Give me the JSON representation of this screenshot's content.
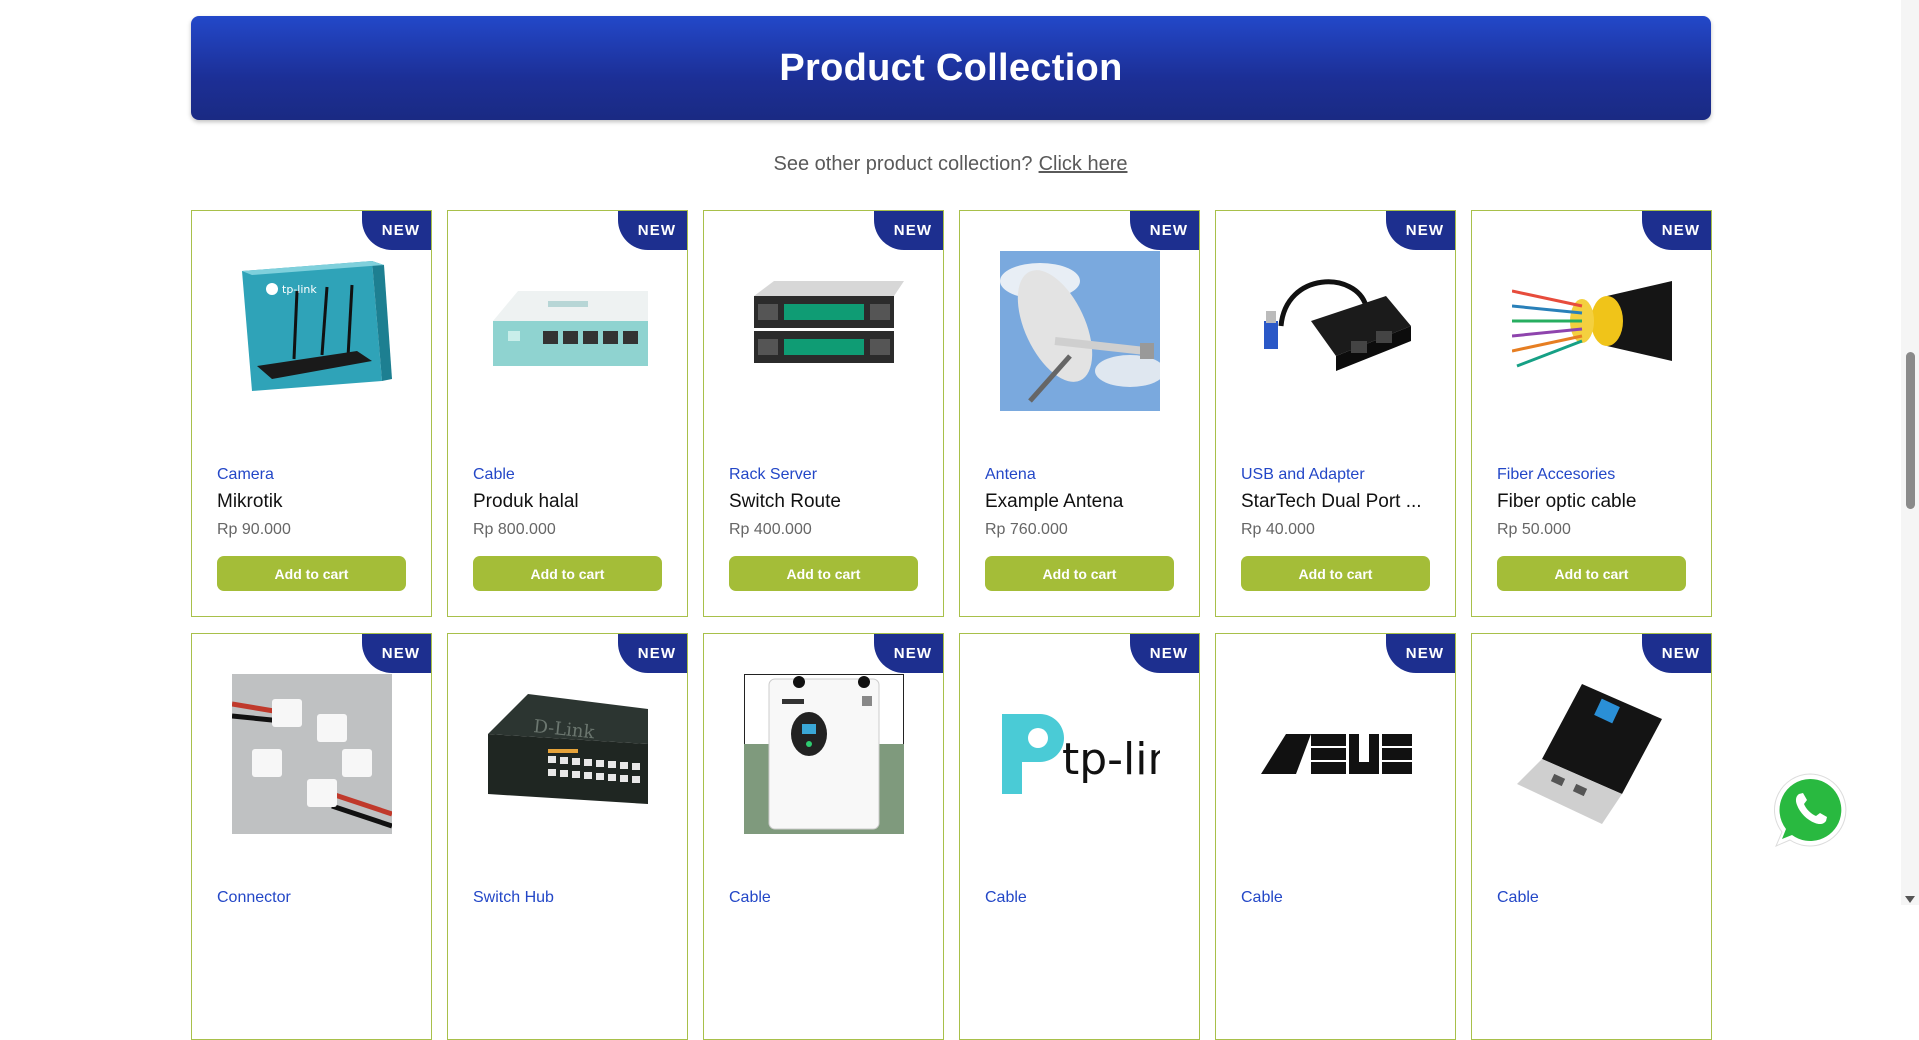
{
  "header": {
    "title": "Product Collection"
  },
  "subline": {
    "text": "See other product collection?",
    "link": "Click here"
  },
  "badge_text": "NEW",
  "cart_label": "Add to cart",
  "products": [
    {
      "category": "Camera",
      "name": "Mikrotik",
      "price": "Rp 90.000",
      "image": "router-box"
    },
    {
      "category": "Cable",
      "name": "Produk halal",
      "price": "Rp 800.000",
      "image": "mikrotik-router"
    },
    {
      "category": "Rack Server",
      "name": "Switch Route",
      "price": "Rp 400.000",
      "image": "rack-server"
    },
    {
      "category": "Antena",
      "name": "Example Antena",
      "price": "Rp 760.000",
      "image": "satellite-dish"
    },
    {
      "category": "USB and Adapter",
      "name": "StarTech Dual Port ...",
      "price": "Rp 40.000",
      "image": "usb-ethernet-adapter"
    },
    {
      "category": "Fiber Accesories",
      "name": "Fiber optic cable",
      "price": "Rp 50.000",
      "image": "fiber-optic-cable"
    },
    {
      "category": "Connector",
      "name": "",
      "price": "",
      "image": "power-connectors"
    },
    {
      "category": "Switch Hub",
      "name": "",
      "price": "",
      "image": "dlink-switch"
    },
    {
      "category": "Cable",
      "name": "",
      "price": "",
      "image": "inverter"
    },
    {
      "category": "Cable",
      "name": "",
      "price": "",
      "image": "tplink-logo"
    },
    {
      "category": "Cable",
      "name": "",
      "price": "",
      "image": "asus-logo"
    },
    {
      "category": "Cable",
      "name": "",
      "price": "",
      "image": "wifi-dongle"
    }
  ],
  "widgets": {
    "whatsapp_icon": "whatsapp-icon"
  }
}
